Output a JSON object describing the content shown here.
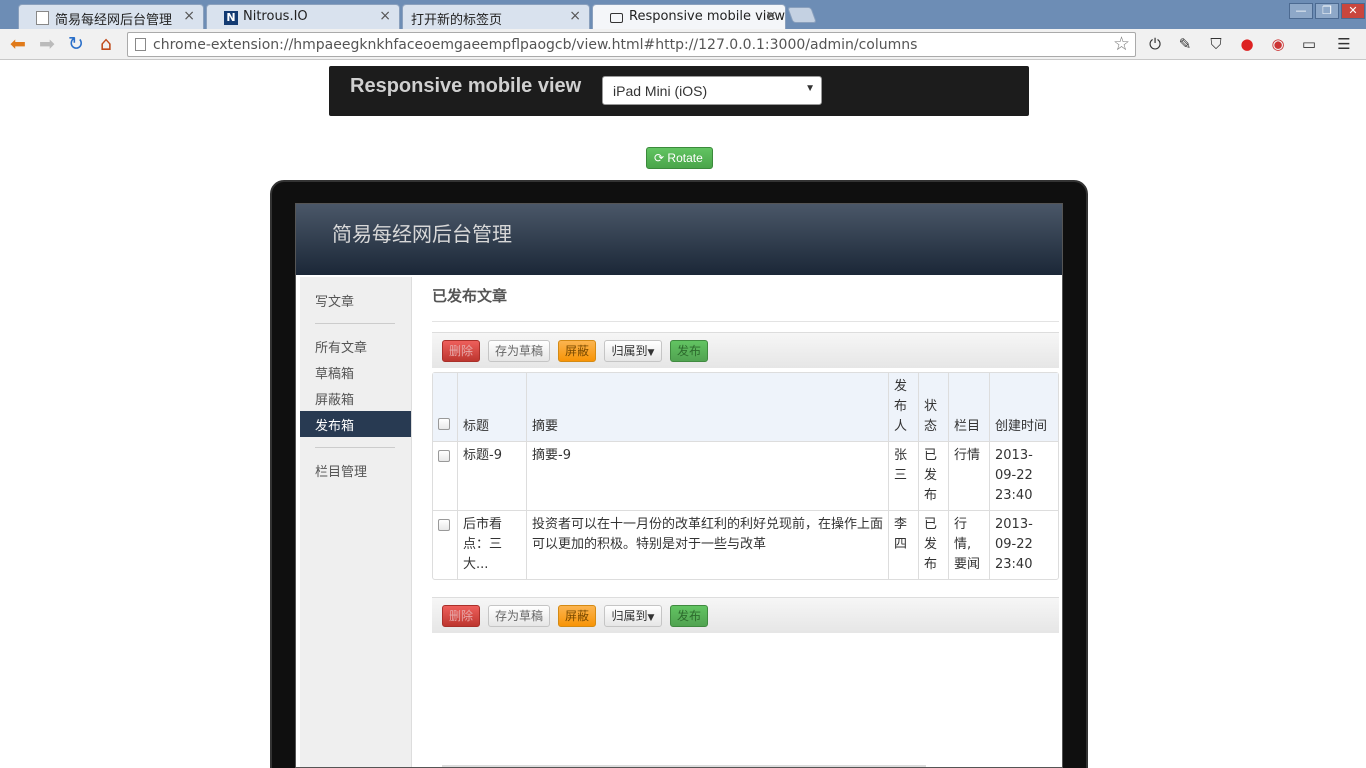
{
  "browser": {
    "tabs": [
      {
        "title": "简易每经网后台管理",
        "favicon": "document-icon"
      },
      {
        "title": "Nitrous.IO",
        "favicon": "nitrous-icon"
      },
      {
        "title": "打开新的标签页",
        "favicon": "none"
      },
      {
        "title": "Responsive mobile view",
        "favicon": "monitor-icon",
        "active": true
      }
    ],
    "url": "chrome-extension://hmpaeegknkhfaceoemgaeempflpaogcb/view.html#http://127.0.0.1:3000/admin/columns",
    "close_glyph": "×",
    "window_controls": {
      "minimize": "—",
      "restore": "❐",
      "close": "✕"
    }
  },
  "viewer": {
    "title": "Responsive mobile view",
    "device_select": "iPad Mini (iOS)",
    "rotate_label": "Rotate"
  },
  "admin": {
    "site_title": "简易每经网后台管理",
    "sidebar": {
      "write": "写文章",
      "all": "所有文章",
      "drafts": "草稿箱",
      "blocked": "屏蔽箱",
      "published": "发布箱",
      "columns": "栏目管理"
    },
    "page_title": "已发布文章",
    "actions": {
      "delete": "删除",
      "save_draft": "存为草稿",
      "block": "屏蔽",
      "move_to": "归属到",
      "publish": "发布"
    },
    "table": {
      "headers": {
        "title": "标题",
        "summary": "摘要",
        "author": "发布人",
        "status": "状态",
        "column": "栏目",
        "created": "创建时间"
      },
      "rows": [
        {
          "title": "标题-9",
          "summary": "摘要-9",
          "author": "张三",
          "status": "已发布",
          "column": "行情",
          "created": "2013-09-22 23:40"
        },
        {
          "title": "后市看点：三大...",
          "summary": "投资者可以在十一月份的改革红利的利好兑现前，在操作上面可以更加的积极。特别是对于一些与改革",
          "author": "李四",
          "status": "已发布",
          "column": "行情, 要闻",
          "created": "2013-09-22 23:40"
        }
      ]
    }
  },
  "colors": {
    "header_dark": "#1b2737",
    "sidebar_active": "#283a52",
    "rotate_green": "#51a351"
  }
}
